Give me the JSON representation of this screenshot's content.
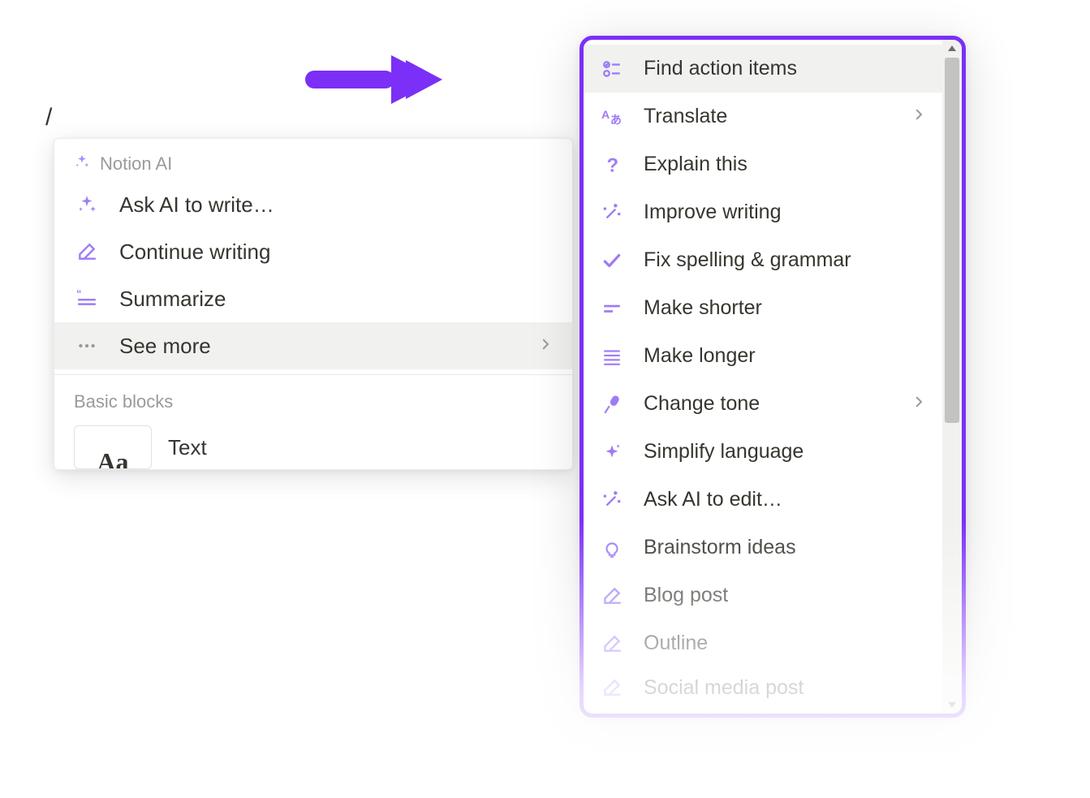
{
  "slash_char": "/",
  "left_menu": {
    "header_label": "Notion AI",
    "items": [
      {
        "id": "ask-ai-write",
        "label": "Ask AI to write…",
        "icon": "sparkle",
        "highlighted": false,
        "has_chevron": false
      },
      {
        "id": "continue-writing",
        "label": "Continue writing",
        "icon": "pencil-line",
        "highlighted": false,
        "has_chevron": false
      },
      {
        "id": "summarize",
        "label": "Summarize",
        "icon": "quote-lines",
        "highlighted": false,
        "has_chevron": false
      },
      {
        "id": "see-more",
        "label": "See more",
        "icon": "dots",
        "highlighted": true,
        "has_chevron": true
      }
    ],
    "basic_blocks_header": "Basic blocks",
    "basic_blocks": [
      {
        "id": "text",
        "label": "Text",
        "thumb": "Aa"
      }
    ]
  },
  "right_menu": {
    "items": [
      {
        "id": "find-action-items",
        "label": "Find action items",
        "icon": "checklist",
        "highlighted": true,
        "has_chevron": false
      },
      {
        "id": "translate",
        "label": "Translate",
        "icon": "translate",
        "highlighted": false,
        "has_chevron": true
      },
      {
        "id": "explain-this",
        "label": "Explain this",
        "icon": "question",
        "highlighted": false,
        "has_chevron": false
      },
      {
        "id": "improve-writing",
        "label": "Improve writing",
        "icon": "wand-sparkle",
        "highlighted": false,
        "has_chevron": false
      },
      {
        "id": "fix-spelling",
        "label": "Fix spelling & grammar",
        "icon": "check",
        "highlighted": false,
        "has_chevron": false
      },
      {
        "id": "make-shorter",
        "label": "Make shorter",
        "icon": "short-lines",
        "highlighted": false,
        "has_chevron": false
      },
      {
        "id": "make-longer",
        "label": "Make longer",
        "icon": "long-lines",
        "highlighted": false,
        "has_chevron": false
      },
      {
        "id": "change-tone",
        "label": "Change tone",
        "icon": "microphone",
        "highlighted": false,
        "has_chevron": true
      },
      {
        "id": "simplify-language",
        "label": "Simplify language",
        "icon": "sparkle-star",
        "highlighted": false,
        "has_chevron": false
      },
      {
        "id": "ask-ai-edit",
        "label": "Ask AI to edit…",
        "icon": "wand-sparkle",
        "highlighted": false,
        "has_chevron": false
      },
      {
        "id": "brainstorm",
        "label": "Brainstorm ideas",
        "icon": "lightbulb",
        "highlighted": false,
        "has_chevron": false
      },
      {
        "id": "blog-post",
        "label": "Blog post",
        "icon": "pencil-line",
        "highlighted": false,
        "has_chevron": false
      },
      {
        "id": "outline",
        "label": "Outline",
        "icon": "pencil-line",
        "highlighted": false,
        "has_chevron": false
      },
      {
        "id": "social-media",
        "label": "Social media post",
        "icon": "pencil-line",
        "highlighted": false,
        "has_chevron": false
      }
    ]
  },
  "colors": {
    "accent": "#7b2ff7",
    "icon": "#9e7cf5"
  }
}
